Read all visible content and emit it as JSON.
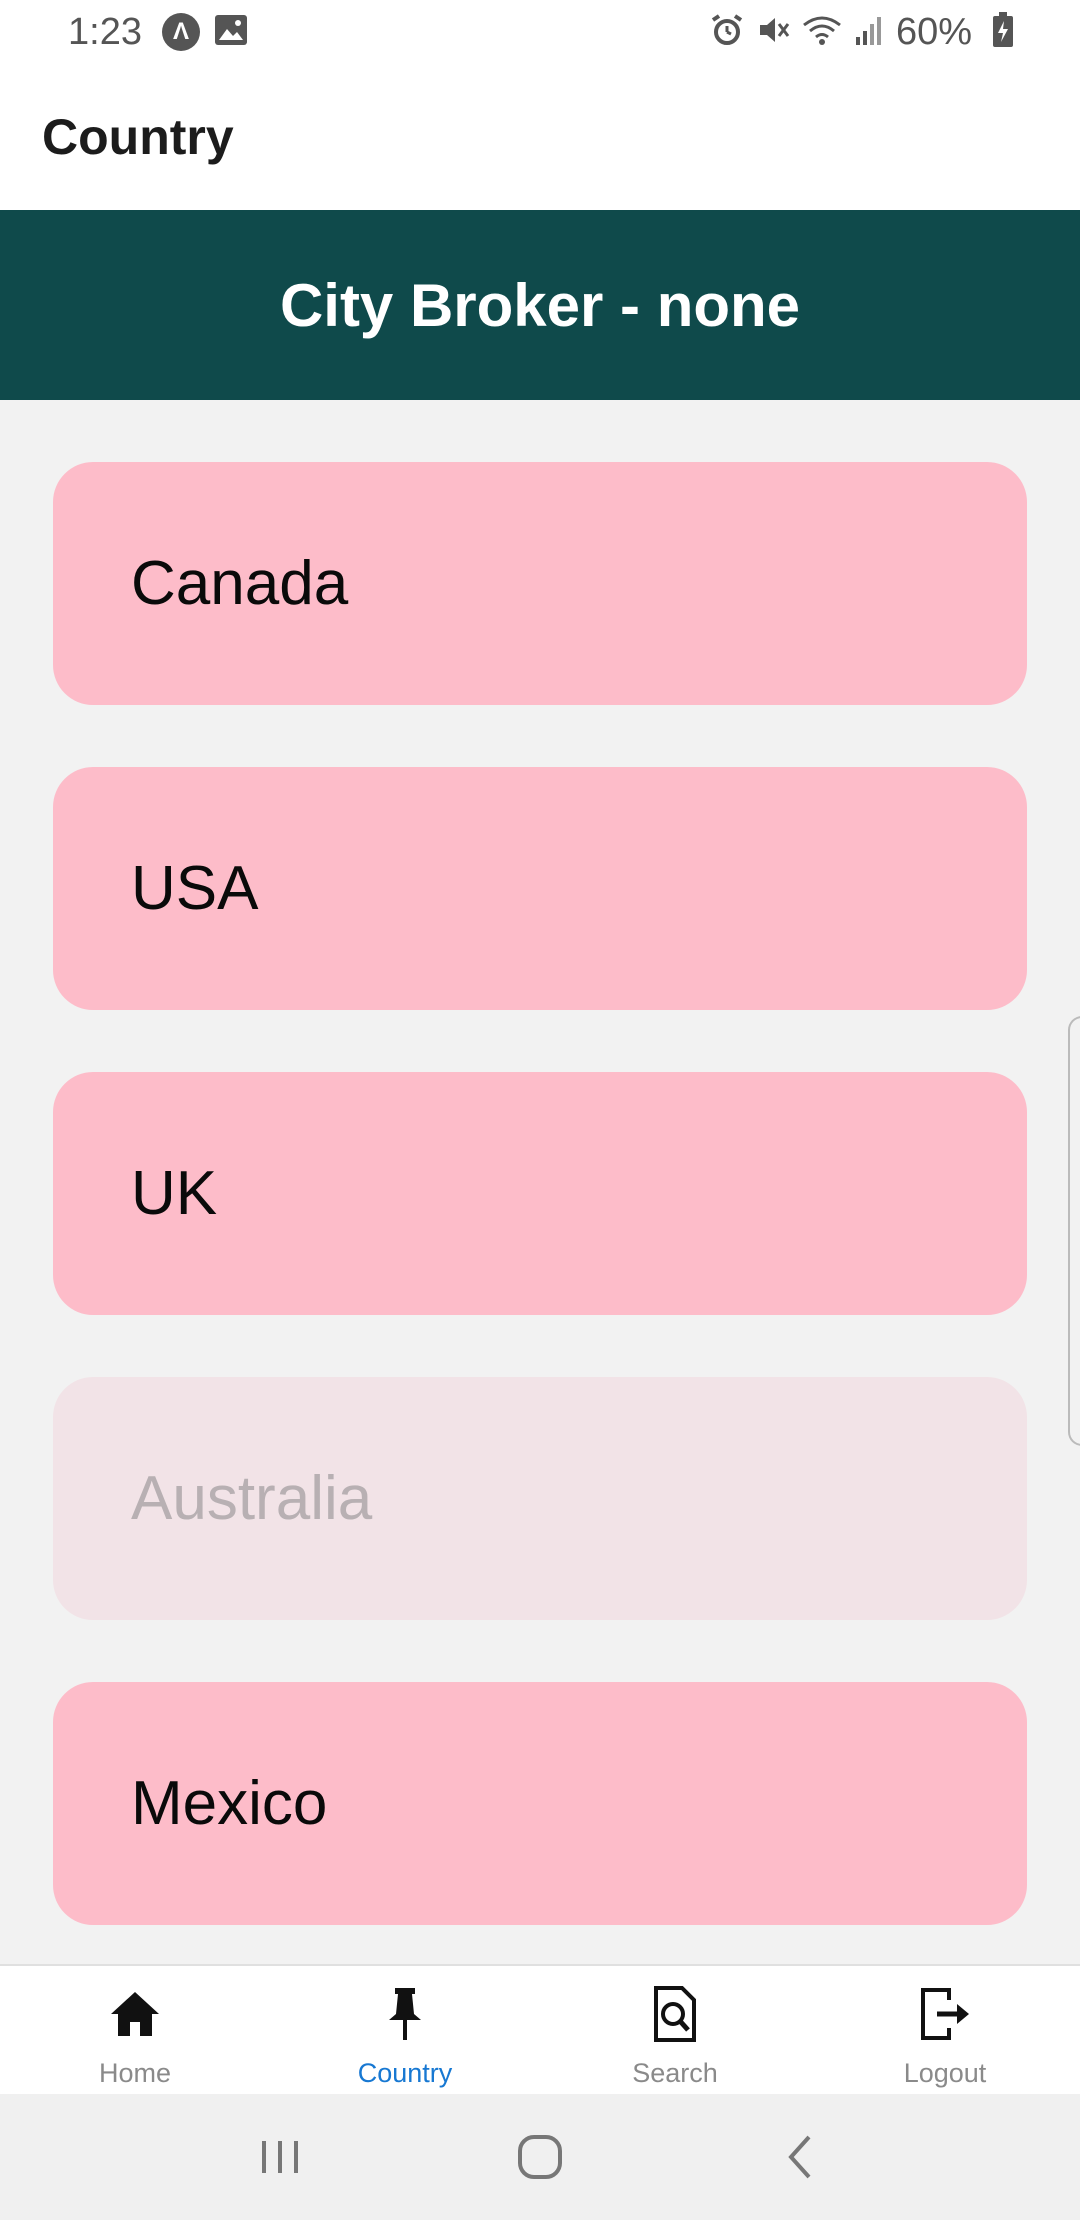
{
  "status_bar": {
    "time": "1:23",
    "battery": "60%"
  },
  "header": {
    "title": "Country"
  },
  "banner": {
    "title": "City Broker - none"
  },
  "countries": [
    {
      "name": "Canada",
      "enabled": true
    },
    {
      "name": "USA",
      "enabled": true
    },
    {
      "name": "UK",
      "enabled": true
    },
    {
      "name": "Australia",
      "enabled": false
    },
    {
      "name": "Mexico",
      "enabled": true
    }
  ],
  "tabs": [
    {
      "label": "Home",
      "icon": "home-icon",
      "active": false
    },
    {
      "label": "Country",
      "icon": "pin-icon",
      "active": true
    },
    {
      "label": "Search",
      "icon": "search-document-icon",
      "active": false
    },
    {
      "label": "Logout",
      "icon": "logout-icon",
      "active": false
    }
  ],
  "colors": {
    "banner_bg": "#0f4a4b",
    "card_bg": "#fdbcc9",
    "card_disabled_bg": "#f2e3e7",
    "tab_active": "#1778d2",
    "tab_inactive": "#8a8a8a"
  }
}
